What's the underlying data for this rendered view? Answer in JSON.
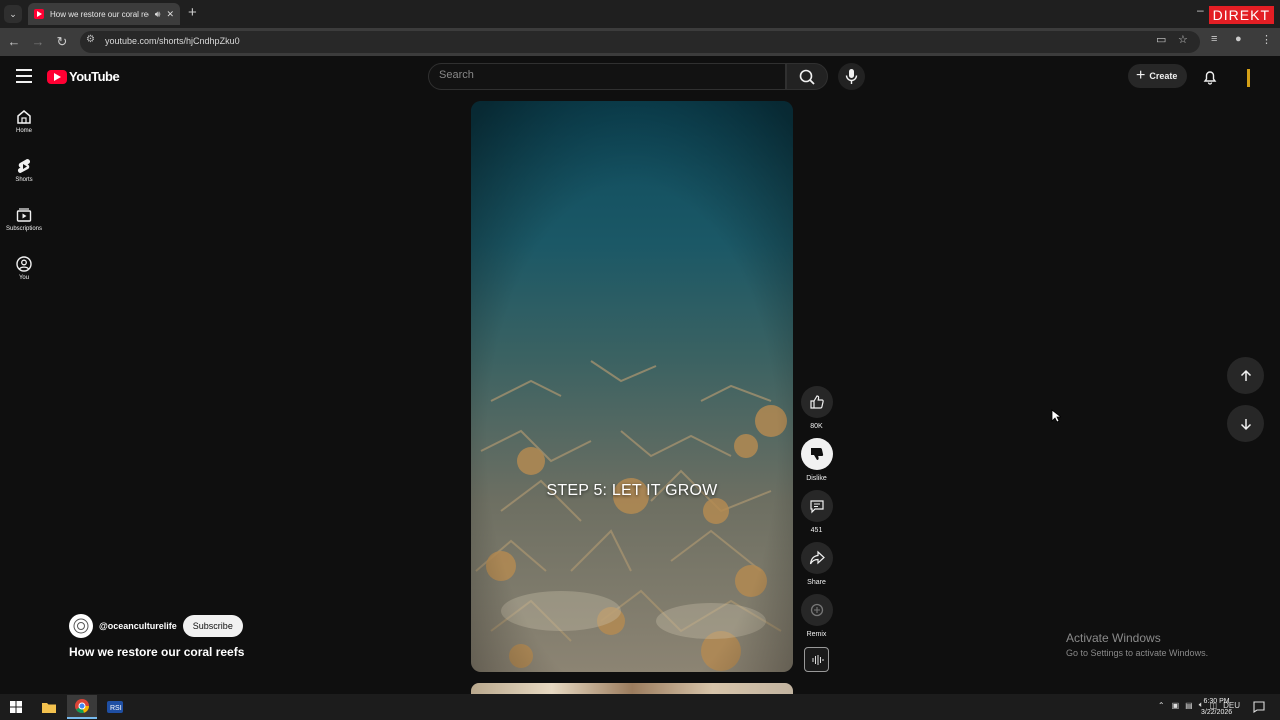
{
  "browser": {
    "tab_title": "How we restore our coral reefs - YouTube",
    "url": "youtube.com/shorts/hjCndhpZku0",
    "badge": "DIREKT"
  },
  "header": {
    "logo_text": "YouTube",
    "search_placeholder": "Search",
    "create_label": "Create"
  },
  "sidebar": {
    "items": [
      {
        "label": "Home"
      },
      {
        "label": "Shorts"
      },
      {
        "label": "Subscriptions"
      },
      {
        "label": "You"
      }
    ]
  },
  "video": {
    "overlay_text": "STEP 5: LET IT GROW"
  },
  "actions": {
    "like_count": "80K",
    "dislike_label": "Dislike",
    "comment_count": "451",
    "share_label": "Share",
    "remix_label": "Remix"
  },
  "channel": {
    "handle": "@oceanculturelife",
    "subscribe_label": "Subscribe",
    "title": "How we restore our coral reefs"
  },
  "watermark": {
    "line1": "Activate Windows",
    "line2": "Go to Settings to activate Windows."
  },
  "taskbar": {
    "language": "DEU",
    "time": "6:30 PM",
    "date": "3/22/2026"
  },
  "colors": {
    "brand_red": "#ff0033",
    "background": "#0f0f0f",
    "direkt_red": "#e31e24"
  }
}
